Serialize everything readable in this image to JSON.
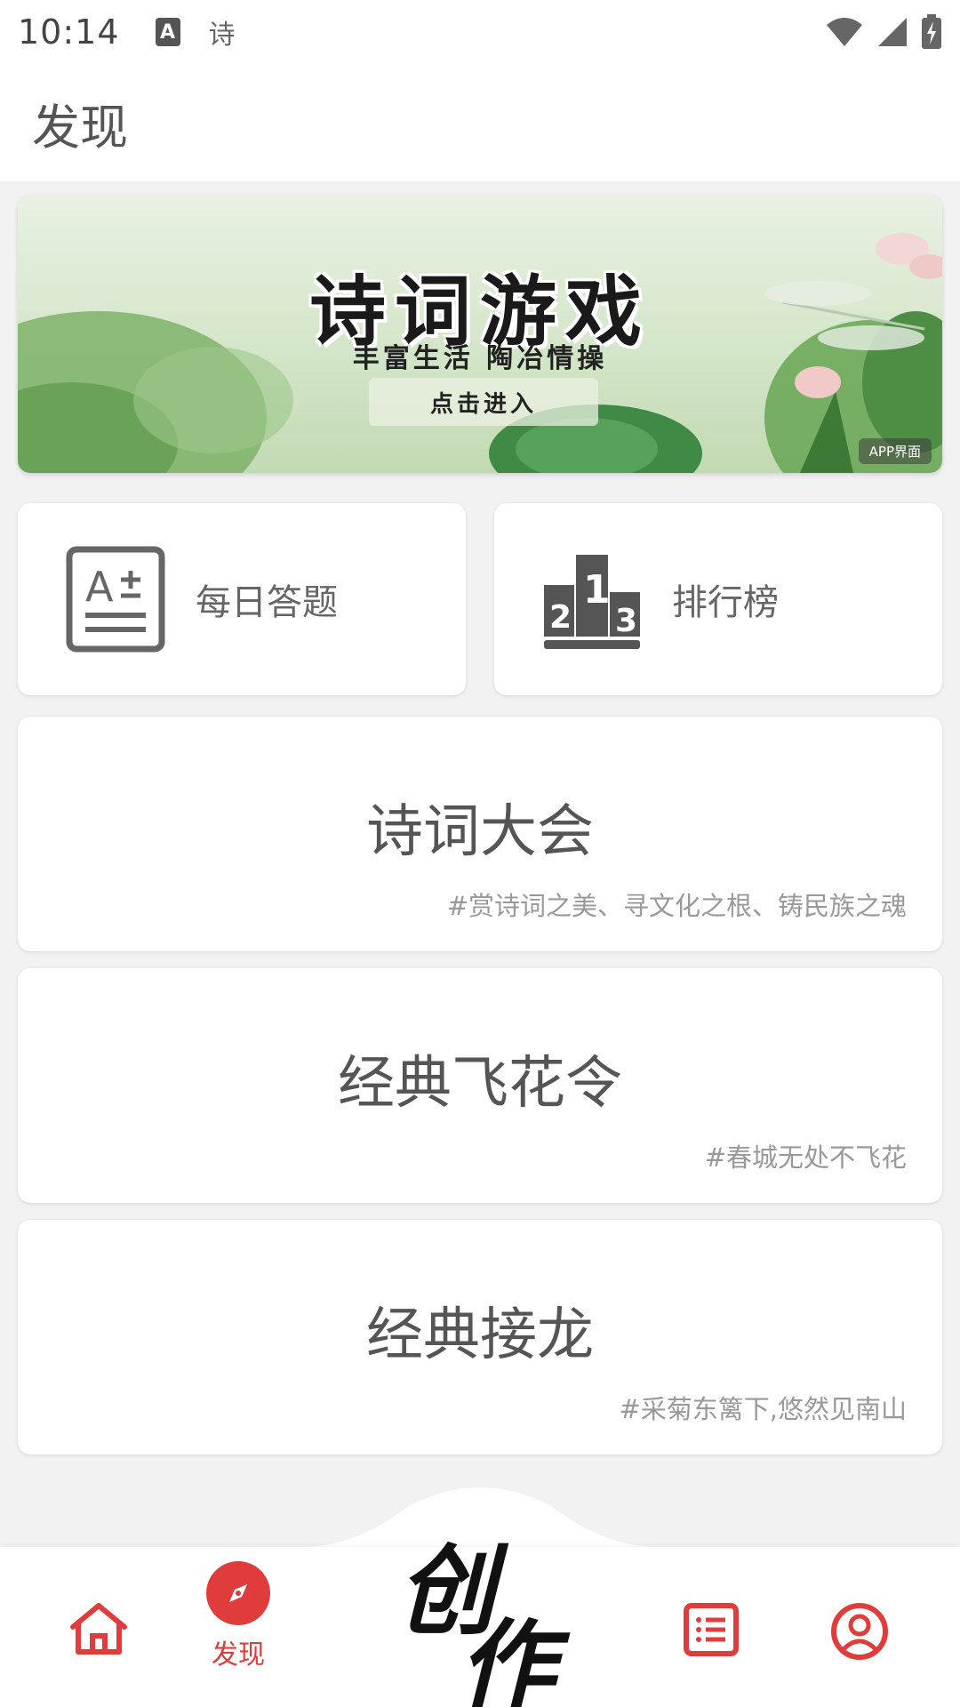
{
  "status_bar": {
    "time": "10:14",
    "app_indicator": "A",
    "notification_text": "诗"
  },
  "header": {
    "title": "发现"
  },
  "banner": {
    "title": "诗词游戏",
    "subtitle": "丰富生活 陶冶情操",
    "button_label": "点击进入",
    "tag": "APP界面"
  },
  "features": {
    "daily": {
      "label": "每日答题",
      "icon": "quiz-icon"
    },
    "rank": {
      "label": "排行榜",
      "icon": "podium-icon",
      "podium_numbers": [
        "2",
        "1",
        "3"
      ]
    }
  },
  "sections": [
    {
      "title": "诗词大会",
      "tagline": "#赏诗词之美、寻文化之根、铸民族之魂"
    },
    {
      "title": "经典飞花令",
      "tagline": "#春城无处不飞花"
    },
    {
      "title": "经典接龙",
      "tagline": "#采菊东篱下,悠然见南山"
    }
  ],
  "bottom_nav": {
    "home": {
      "icon": "home-icon"
    },
    "discover": {
      "label": "发现",
      "icon": "compass-icon",
      "active": true
    },
    "create": {
      "label_1": "创",
      "label_2": "作"
    },
    "list": {
      "icon": "list-icon"
    },
    "profile": {
      "icon": "user-icon"
    }
  },
  "colors": {
    "accent": "#e03c3c",
    "background": "#f2f2f2"
  }
}
